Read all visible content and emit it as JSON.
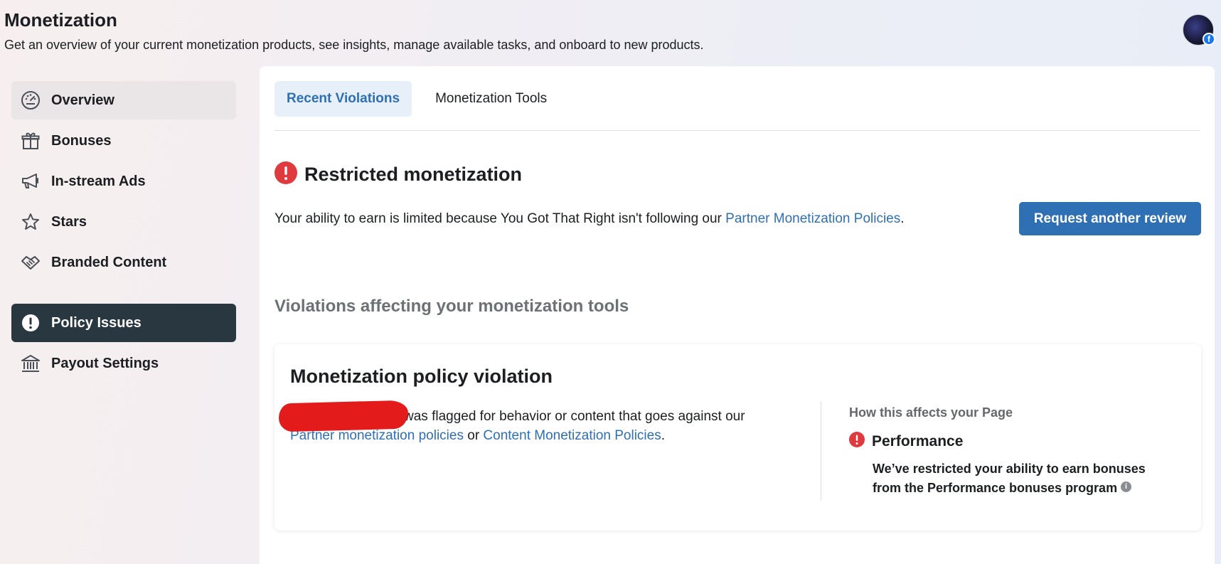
{
  "header": {
    "title": "Monetization",
    "subtitle": "Get an overview of your current monetization products, see insights, manage available tasks, and onboard to new products."
  },
  "sidebar": {
    "items": [
      {
        "label": "Overview",
        "icon": "gauge-icon"
      },
      {
        "label": "Bonuses",
        "icon": "gift-icon"
      },
      {
        "label": "In-stream Ads",
        "icon": "megaphone-icon"
      },
      {
        "label": "Stars",
        "icon": "star-icon"
      },
      {
        "label": "Branded Content",
        "icon": "handshake-icon"
      },
      {
        "label": "Policy Issues",
        "icon": "alert-icon"
      },
      {
        "label": "Payout Settings",
        "icon": "bank-icon"
      }
    ]
  },
  "tabs": [
    {
      "label": "Recent Violations"
    },
    {
      "label": "Monetization Tools"
    }
  ],
  "restricted": {
    "title": "Restricted monetization",
    "desc_prefix": "Your ability to earn is limited because You Got That Right isn't following our ",
    "policy_link": "Partner Monetization Policies",
    "desc_suffix": ".",
    "button_label": "Request another review"
  },
  "violations": {
    "heading": "Violations affecting your monetization tools",
    "card": {
      "title": "Monetization policy violation",
      "desc_text": "was flagged for behavior or content that goes against our ",
      "link1": "Partner monetization policies",
      "or_text": " or ",
      "link2": "Content Monetization Policies",
      "end": ".",
      "affects_label": "How this affects your Page",
      "performance_title": "Performance",
      "performance_desc": "We’ve restricted your ability to earn bonuses from the Performance bonuses program"
    }
  },
  "colors": {
    "accent": "#2f6fb4",
    "alert": "#e0393e",
    "active_nav": "#283740"
  }
}
